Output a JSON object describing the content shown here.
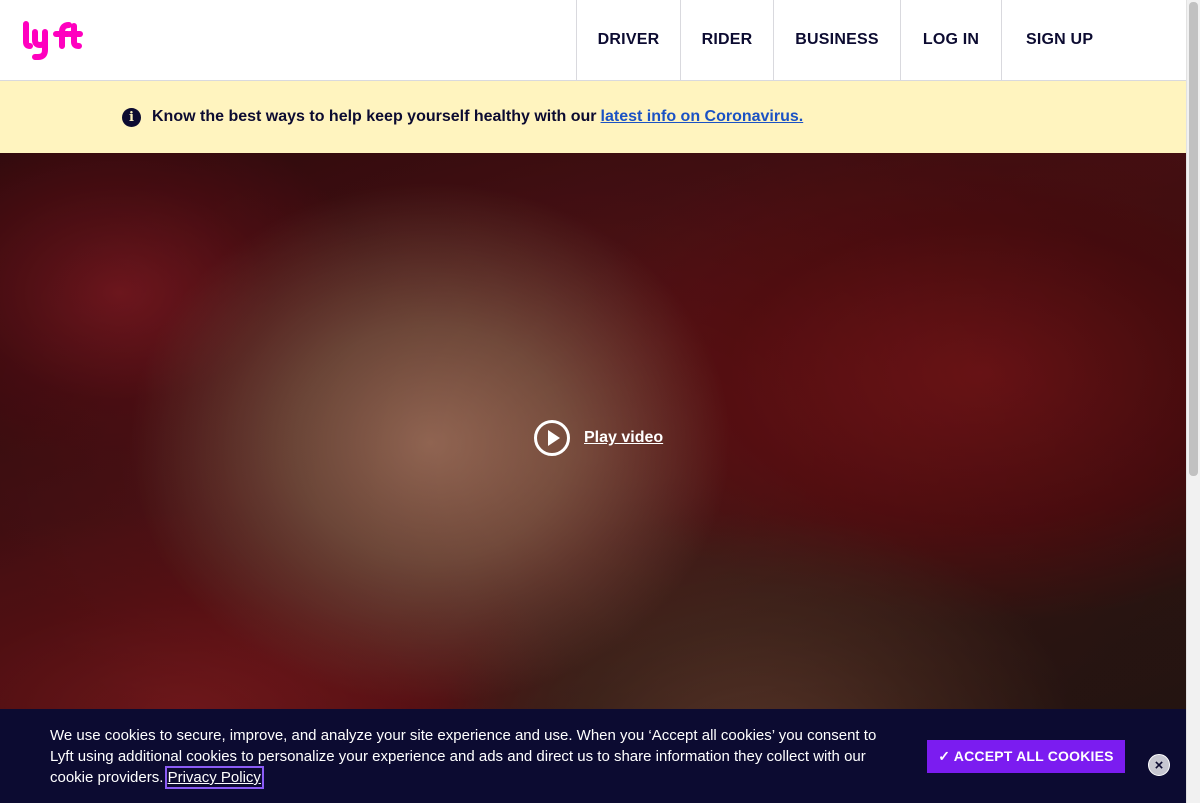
{
  "header": {
    "logo_alt": "lyft",
    "brand_color": "#ff00bf",
    "nav": [
      {
        "label": "DRIVER"
      },
      {
        "label": "RIDER"
      },
      {
        "label": "BUSINESS"
      },
      {
        "label": "LOG IN"
      },
      {
        "label": "SIGN UP"
      }
    ]
  },
  "banner": {
    "icon": "info-icon",
    "text": "Know the best ways to help keep yourself healthy with our",
    "link": "latest info on Coronavirus."
  },
  "hero": {
    "play_icon": "play-icon",
    "play_label": "Play video"
  },
  "cookie": {
    "text": "We use cookies to secure, improve, and analyze your site experience and use. When you ‘Accept all cookies’ you consent to Lyft using additional cookies to personalize your experience and ads and direct us to share information they collect with our cookie providers.",
    "privacy_link": "Privacy Policy",
    "accept_label": "✓ ACCEPT ALL COOKIES",
    "close_icon": "close-icon",
    "accent_color": "#7b1cf0"
  }
}
